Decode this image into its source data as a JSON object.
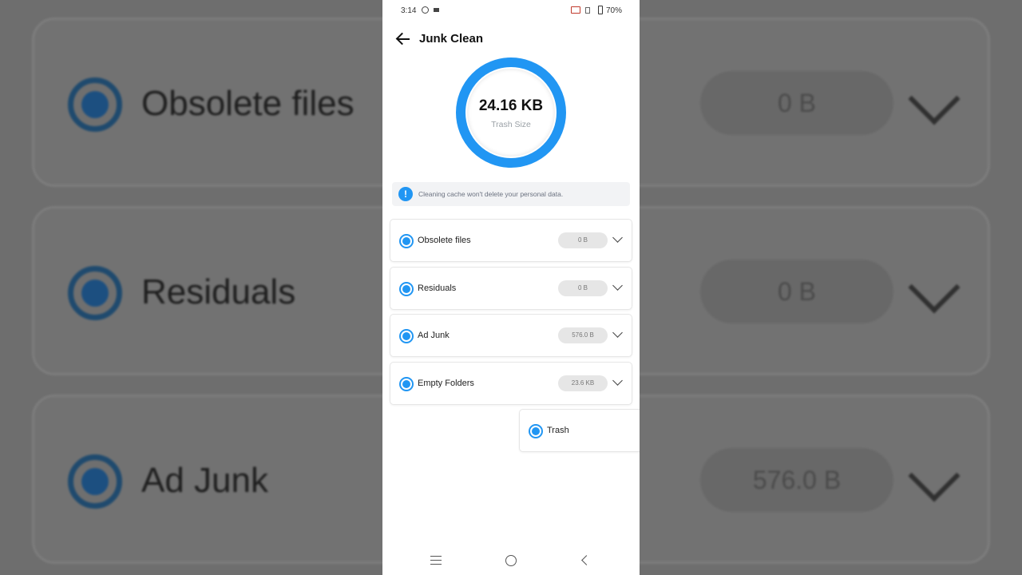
{
  "status": {
    "time": "3:14",
    "battery": "70%"
  },
  "header": {
    "title": "Junk Clean"
  },
  "summary": {
    "size": "24.16 KB",
    "label": "Trash Size"
  },
  "info": {
    "message": "Cleaning cache won't delete your personal data."
  },
  "items": [
    {
      "label": "Obsolete files",
      "size": "0 B"
    },
    {
      "label": "Residuals",
      "size": "0 B"
    },
    {
      "label": "Ad Junk",
      "size": "576.0 B"
    },
    {
      "label": "Empty Folders",
      "size": "23.6 KB"
    },
    {
      "label": "Trash"
    }
  ],
  "colors": {
    "accent": "#2196f3",
    "background": "#ffffff"
  },
  "icons": {
    "back": "arrow-left-icon",
    "info": "exclamation-icon",
    "expand": "chevron-down-icon"
  }
}
